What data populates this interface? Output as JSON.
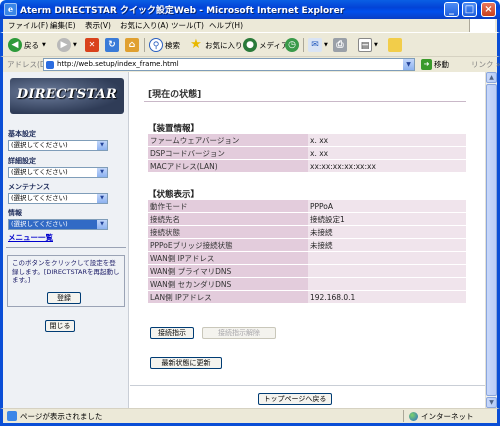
{
  "window": {
    "title": "Aterm DIRECTSTAR クイック設定Web - Microsoft Internet Explorer",
    "icon_label": "e",
    "minimize": "_",
    "maximize": "□",
    "close": "×"
  },
  "menubar": [
    "ファイル(F)",
    "編集(E)",
    "表示(V)",
    "お気に入り(A)",
    "ツール(T)",
    "ヘルプ(H)"
  ],
  "toolbar": {
    "back": "戻る",
    "search": "検索",
    "favorites": "お気に入り",
    "media": "メディア"
  },
  "address": {
    "label": "アドレス(D)",
    "url": "http://web.setup/index_frame.html",
    "go": "移動",
    "links": "リンク »"
  },
  "sidebar": {
    "logo": "DIRECTSTAR",
    "sections": [
      {
        "label": "基本設定",
        "value": "(選択してください)"
      },
      {
        "label": "詳細設定",
        "value": "(選択してください)"
      },
      {
        "label": "メンテナンス",
        "value": "(選択してください)"
      },
      {
        "label": "情報",
        "value": "(選択してください)"
      }
    ],
    "menu_list": "メニュー一覧",
    "note": "このボタンをクリックして設定を登録します。[DIRECTSTARを再起動します。]",
    "register_button": "登録",
    "close_button": "閉じる"
  },
  "main": {
    "title": "[現在の状態]",
    "device_info": {
      "heading": "【装置情報】",
      "rows": [
        {
          "key": "ファームウェアバージョン",
          "value": "x. xx"
        },
        {
          "key": "DSPコードバージョン",
          "value": "x. xx"
        },
        {
          "key": "MACアドレス(LAN)",
          "value": "xx:xx:xx:xx:xx:xx"
        }
      ]
    },
    "status": {
      "heading": "【状態表示】",
      "rows": [
        {
          "key": "動作モード",
          "value": "PPPoA"
        },
        {
          "key": "接続先名",
          "value": "接続設定1"
        },
        {
          "key": "接続状態",
          "value": "未接続"
        },
        {
          "key": "PPPoEブリッジ接続状態",
          "value": "未接続"
        },
        {
          "key": "WAN側 IPアドレス",
          "value": ""
        },
        {
          "key": "WAN側 プライマリDNS",
          "value": ""
        },
        {
          "key": "WAN側 セカンダリDNS",
          "value": ""
        },
        {
          "key": "LAN側 IPアドレス",
          "value": "192.168.0.1"
        }
      ]
    },
    "connect_button": "接続指示",
    "disconnect_button": "接続指示解除",
    "refresh_button": "最新状態に更新",
    "top_button": "トップページへ戻る"
  },
  "statusbar": {
    "text": "ページが表示されました",
    "zone": "インターネット"
  }
}
